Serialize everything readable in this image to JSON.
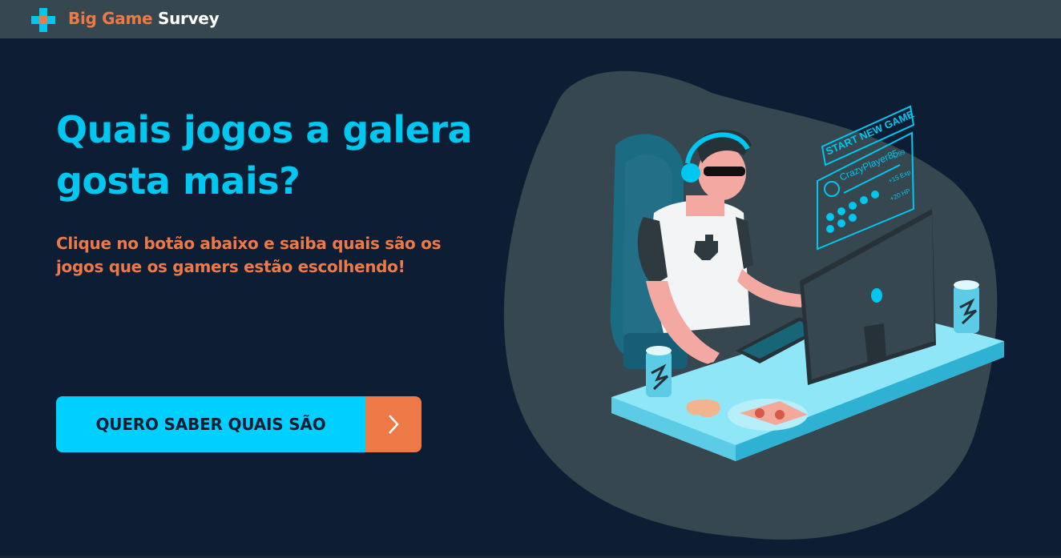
{
  "navbar": {
    "brand_part1": "Big Game",
    "brand_part2": "Survey",
    "logo_icon": "gamepad-cross-icon"
  },
  "hero": {
    "title": "Quais jogos a galera gosta mais?",
    "subtitle": "Clique no botão abaixo e saiba quais são os jogos que os gamers estão escolhendo!",
    "cta_label": "QUERO SABER QUAIS SÃO",
    "cta_icon": "chevron-right-icon"
  },
  "illustration": {
    "hud_title": "START NEW GAME",
    "hud_player": "CrazyPlayer85",
    "hud_level": "L.99",
    "hud_exp": "+15 Exp",
    "hud_hp": "+20 HP"
  },
  "colors": {
    "navbar": "#37474f",
    "background": "#0d1d33",
    "accent_cyan": "#00c7f0",
    "accent_orange": "#ed7947"
  }
}
